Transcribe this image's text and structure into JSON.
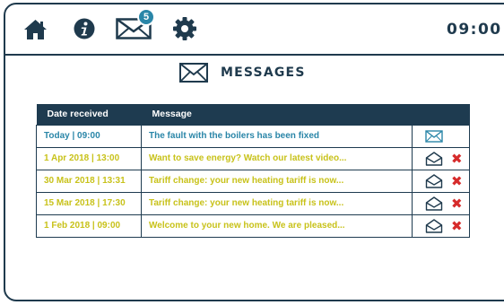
{
  "topbar": {
    "icons": [
      "home-icon",
      "info-icon",
      "mail-icon",
      "gear-icon"
    ],
    "unread_count": "5",
    "clock": "09:00"
  },
  "heading": {
    "title": "MESSAGES",
    "icon": "mail-icon"
  },
  "table": {
    "columns": [
      "Date received",
      "Message"
    ],
    "rows": [
      {
        "date": "Today  |  09:00",
        "message": "The fault with the boilers has been fixed",
        "status": "unread",
        "deletable": false
      },
      {
        "date": "1 Apr 2018  |  13:00",
        "message": "Want to save energy? Watch our latest video...",
        "status": "read",
        "deletable": true
      },
      {
        "date": "30 Mar 2018  |  13:31",
        "message": "Tariff change: your new heating tariff is now...",
        "status": "read",
        "deletable": true
      },
      {
        "date": "15 Mar 2018  |  17:30",
        "message": "Tariff change: your new heating tariff is now...",
        "status": "read",
        "deletable": true
      },
      {
        "date": "1 Feb 2018  |  09:00",
        "message": "Welcome to your new home. We are pleased...",
        "status": "read",
        "deletable": true
      }
    ],
    "delete_glyph": "✖"
  },
  "colors": {
    "navy": "#1e3b50",
    "unread_text": "#2a86a8",
    "read_text": "#c8c21a",
    "delete": "#d62b2b",
    "badge": "#2a86a8"
  }
}
